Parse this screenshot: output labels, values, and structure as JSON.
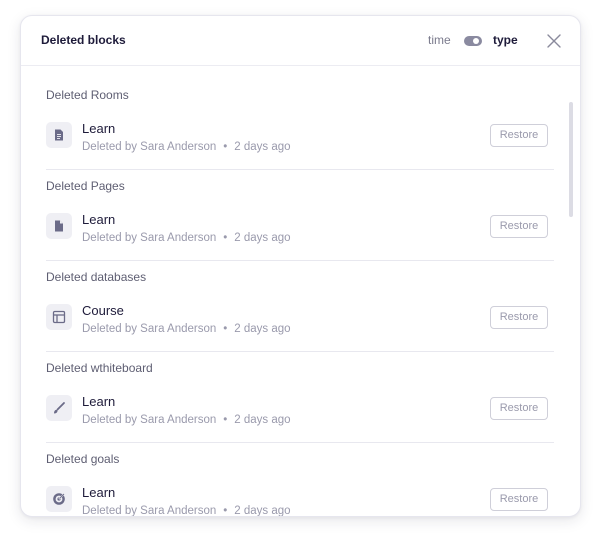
{
  "header": {
    "title": "Deleted blocks",
    "sort_time_label": "time",
    "sort_type_label": "type",
    "sort_toggle_state": "type"
  },
  "sections": [
    {
      "title": "Deleted Rooms",
      "icon": "document-icon",
      "item": {
        "name": "Learn",
        "deleted_by": "Deleted by Sara Anderson",
        "separator": "•",
        "time_ago": "2 days ago",
        "restore_label": "Restore"
      }
    },
    {
      "title": "Deleted Pages",
      "icon": "page-icon",
      "item": {
        "name": "Learn",
        "deleted_by": "Deleted by Sara Anderson",
        "separator": "•",
        "time_ago": "2 days ago",
        "restore_label": "Restore"
      }
    },
    {
      "title": "Deleted databases",
      "icon": "table-icon",
      "item": {
        "name": "Course",
        "deleted_by": "Deleted by Sara Anderson",
        "separator": "•",
        "time_ago": "2 days ago",
        "restore_label": "Restore"
      }
    },
    {
      "title": "Deleted wthiteboard",
      "icon": "brush-icon",
      "item": {
        "name": "Learn",
        "deleted_by": "Deleted by Sara Anderson",
        "separator": "•",
        "time_ago": "2 days ago",
        "restore_label": "Restore"
      }
    },
    {
      "title": "Deleted goals",
      "icon": "target-icon",
      "item": {
        "name": "Learn",
        "deleted_by": "Deleted by Sara Anderson",
        "separator": "•",
        "time_ago": "2 days ago",
        "restore_label": "Restore"
      }
    }
  ],
  "colors": {
    "text_primary": "#1e1b3a",
    "text_secondary": "#9a9aac",
    "icon_fill": "#6b6b88",
    "toggle": "#8a8aa0"
  }
}
